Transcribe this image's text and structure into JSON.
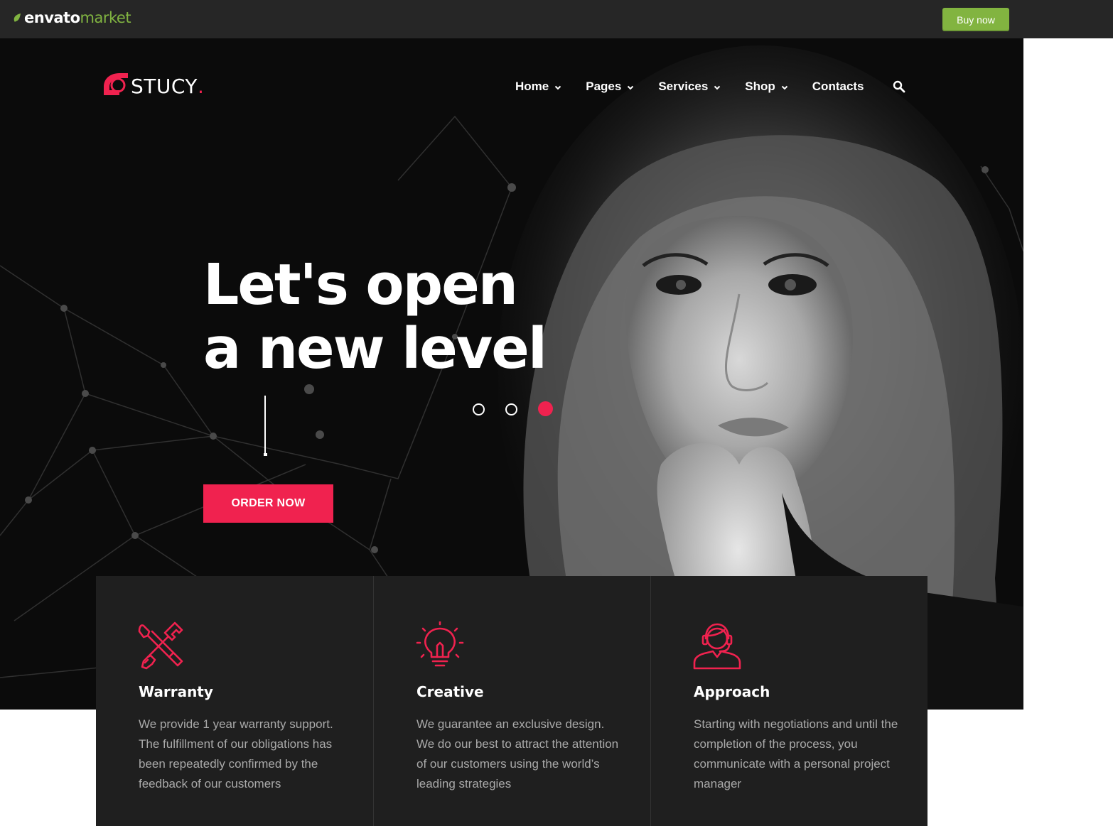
{
  "envato_bar": {
    "logo_main": "envato",
    "logo_secondary": "market",
    "buy_label": "Buy now",
    "colors": {
      "bar": "#262626",
      "accent": "#82b440"
    }
  },
  "header": {
    "brand": "STUCY",
    "brand_dot": ".",
    "nav": [
      {
        "label": "Home",
        "has_dropdown": true
      },
      {
        "label": "Pages",
        "has_dropdown": true
      },
      {
        "label": "Services",
        "has_dropdown": true
      },
      {
        "label": "Shop",
        "has_dropdown": true
      },
      {
        "label": "Contacts",
        "has_dropdown": false
      }
    ],
    "search_icon": "search-icon"
  },
  "hero": {
    "headline_line1": "Let's open",
    "headline_line2": "a new level",
    "cta_label": "ORDER NOW",
    "slider": {
      "total": 3,
      "active": 3
    },
    "colors": {
      "background": "#0b0b0b",
      "accent": "#f0224f"
    }
  },
  "features": [
    {
      "icon": "tools-icon",
      "title": "Warranty",
      "text": "We provide 1 year warranty support. The fulfillment of our obligations has been repeatedly confirmed by the feedback of our customers"
    },
    {
      "icon": "lightbulb-icon",
      "title": "Creative",
      "text": "We guarantee an exclusive design. We do our best to attract the attention of our customers using the world’s leading strategies"
    },
    {
      "icon": "support-agent-icon",
      "title": "Approach",
      "text": "Starting with negotiations and until the completion of the process, you communicate with a personal project manager"
    }
  ]
}
